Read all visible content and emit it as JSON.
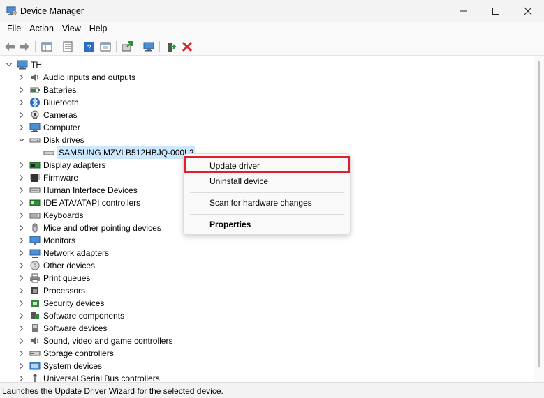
{
  "window": {
    "title": "Device Manager",
    "icon": "device-manager-icon",
    "controls": [
      "minimize-icon",
      "maximize-icon",
      "close-icon"
    ]
  },
  "menu": [
    "File",
    "Action",
    "View",
    "Help"
  ],
  "toolbar": {
    "buttons": [
      "back-arrow-icon",
      "forward-arrow-icon",
      "show-hide-tree-icon",
      "properties-sheet-icon",
      "help-icon",
      "view-options-icon",
      "update-driver-icon",
      "scan-hardware-icon",
      "enable-device-icon",
      "uninstall-device-icon"
    ],
    "accent_red": "#d9232e",
    "accent_blue": "#2b6cc4",
    "accent_green": "#2e8b3a"
  },
  "tree": {
    "root": "TH",
    "categories": [
      {
        "label": "Audio inputs and outputs",
        "icon": "speaker-icon",
        "expanded": false
      },
      {
        "label": "Batteries",
        "icon": "battery-icon",
        "expanded": false
      },
      {
        "label": "Bluetooth",
        "icon": "bluetooth-icon",
        "expanded": false
      },
      {
        "label": "Cameras",
        "icon": "camera-icon",
        "expanded": false
      },
      {
        "label": "Computer",
        "icon": "computer-icon",
        "expanded": false
      },
      {
        "label": "Disk drives",
        "icon": "disk-drive-icon",
        "expanded": true,
        "children": [
          "SAMSUNG MZVLB512HBJQ-000L2"
        ]
      },
      {
        "label": "Display adapters",
        "icon": "display-adapter-icon",
        "expanded": false
      },
      {
        "label": "Firmware",
        "icon": "firmware-icon",
        "expanded": false
      },
      {
        "label": "Human Interface Devices",
        "icon": "hid-icon",
        "expanded": false
      },
      {
        "label": "IDE ATA/ATAPI controllers",
        "icon": "ide-controller-icon",
        "expanded": false
      },
      {
        "label": "Keyboards",
        "icon": "keyboard-icon",
        "expanded": false
      },
      {
        "label": "Mice and other pointing devices",
        "icon": "mouse-icon",
        "expanded": false
      },
      {
        "label": "Monitors",
        "icon": "monitor-icon",
        "expanded": false
      },
      {
        "label": "Network adapters",
        "icon": "network-adapter-icon",
        "expanded": false
      },
      {
        "label": "Other devices",
        "icon": "other-devices-icon",
        "expanded": false
      },
      {
        "label": "Print queues",
        "icon": "printer-icon",
        "expanded": false
      },
      {
        "label": "Processors",
        "icon": "processor-icon",
        "expanded": false
      },
      {
        "label": "Security devices",
        "icon": "security-device-icon",
        "expanded": false
      },
      {
        "label": "Software components",
        "icon": "software-component-icon",
        "expanded": false
      },
      {
        "label": "Software devices",
        "icon": "software-device-icon",
        "expanded": false
      },
      {
        "label": "Sound, video and game controllers",
        "icon": "sound-controller-icon",
        "expanded": false
      },
      {
        "label": "Storage controllers",
        "icon": "storage-controller-icon",
        "expanded": false
      },
      {
        "label": "System devices",
        "icon": "system-device-icon",
        "expanded": false
      },
      {
        "label": "Universal Serial Bus controllers",
        "icon": "usb-icon",
        "expanded": false
      }
    ],
    "selected_device": "SAMSUNG MZVLB512HBJQ-000L2"
  },
  "context_menu": {
    "items": [
      {
        "label": "Update driver",
        "highlighted": true
      },
      {
        "label": "Uninstall device"
      },
      {
        "label": "Scan for hardware changes"
      },
      {
        "label": "Properties",
        "bold": true
      }
    ],
    "highlight_color": "#e0202a"
  },
  "status": {
    "text": "Launches the Update Driver Wizard for the selected device."
  }
}
